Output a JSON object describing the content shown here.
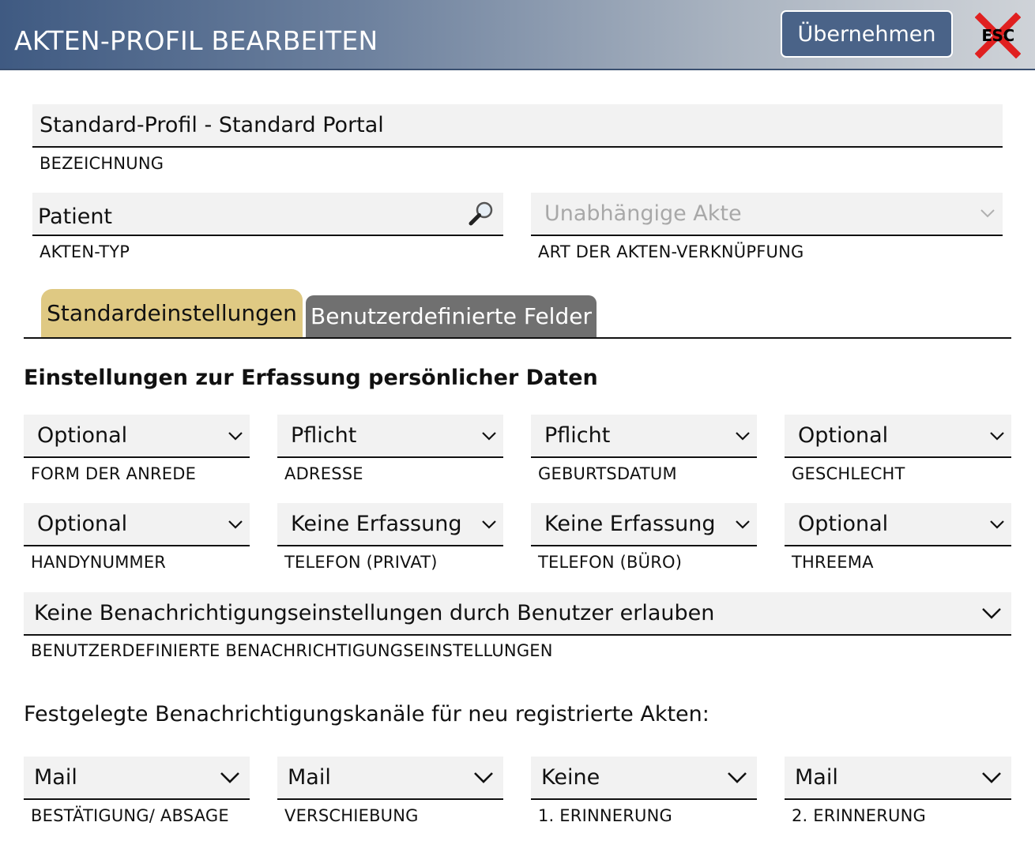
{
  "header": {
    "title": "AKTEN-PROFIL BEARBEITEN",
    "apply_label": "Übernehmen",
    "esc_label": "ESC"
  },
  "profile": {
    "name_value": "Standard-Profil - Standard Portal",
    "name_label": "BEZEICHNUNG",
    "type_value": "Patient",
    "type_label": "AKTEN-TYP",
    "link_value": "Unabhängige Akte",
    "link_label": "ART DER AKTEN-VERKNÜPFUNG"
  },
  "tabs": [
    {
      "label": "Standardeinstellungen",
      "active": true
    },
    {
      "label": "Benutzerdefinierte Felder",
      "active": false
    }
  ],
  "personal": {
    "title": "Einstellungen zur Erfassung persönlicher Daten",
    "fields": [
      {
        "value": "Optional",
        "label": "FORM DER ANREDE"
      },
      {
        "value": "Pflicht",
        "label": "ADRESSE"
      },
      {
        "value": "Pflicht",
        "label": "GEBURTSDATUM"
      },
      {
        "value": "Optional",
        "label": "GESCHLECHT"
      },
      {
        "value": "Optional",
        "label": "HANDYNUMMER"
      },
      {
        "value": "Keine Erfassung",
        "label": "TELEFON (PRIVAT)"
      },
      {
        "value": "Keine Erfassung",
        "label": "TELEFON (BÜRO)"
      },
      {
        "value": "Optional",
        "label": "THREEMA"
      }
    ],
    "notify_value": "Keine Benachrichtigungseinstellungen durch Benutzer erlauben",
    "notify_label": "BENUTZERDEFINIERTE BENACHRICHTIGUNGSEINSTELLUNGEN"
  },
  "channels": {
    "title": "Festgelegte Benachrichtigungskanäle für neu registrierte Akten:",
    "fields": [
      {
        "value": "Mail",
        "label": "BESTÄTIGUNG/ ABSAGE"
      },
      {
        "value": "Mail",
        "label": "VERSCHIEBUNG"
      },
      {
        "value": "Keine",
        "label": "1. ERINNERUNG"
      },
      {
        "value": "Mail",
        "label": "2. ERINNERUNG"
      }
    ]
  },
  "colors": {
    "header_start": "#3f5a82",
    "apply_button": "#4a6388",
    "active_tab": "#dfc983",
    "inactive_tab": "#707070",
    "field_bg": "#f2f2f2",
    "esc_cross": "#e02020"
  },
  "icons": {
    "search": "magnifier-icon",
    "dropdown": "chevron-down-icon",
    "close": "esc-cross-icon"
  }
}
